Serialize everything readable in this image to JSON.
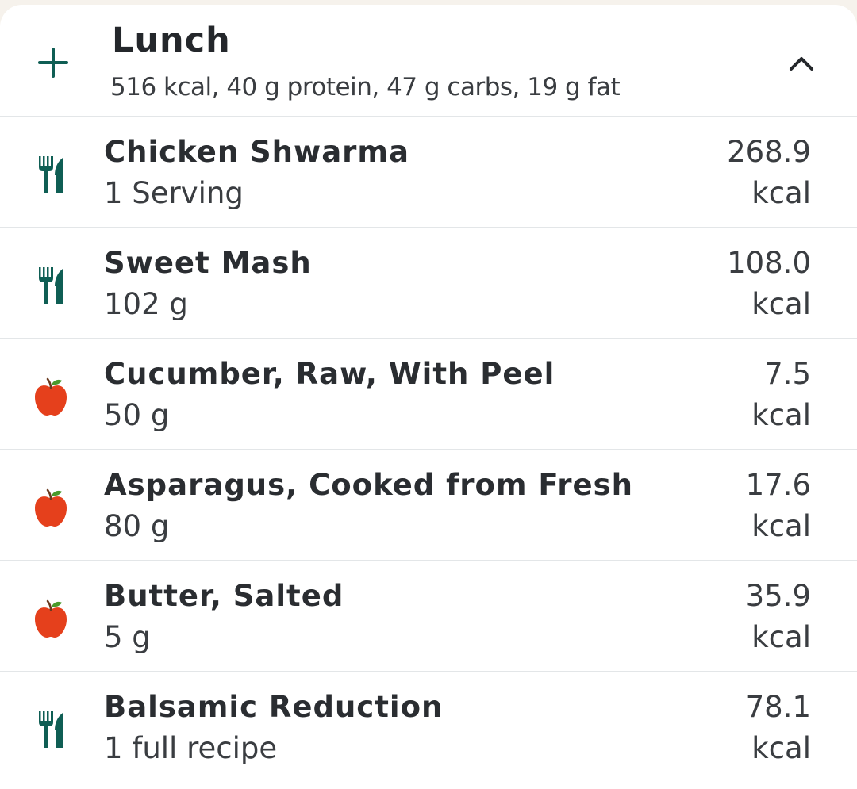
{
  "meal": {
    "title": "Lunch",
    "summary": "516 kcal, 40 g protein, 47 g carbs, 19 g fat"
  },
  "colors": {
    "accent": "#0f5e54",
    "apple": "#e5401c",
    "apple_leaf": "#4a9a2c"
  },
  "items": [
    {
      "icon": "cutlery-icon",
      "name": "Chicken Shwarma",
      "amount": "1 Serving",
      "kcal": "268.9",
      "unit": "kcal"
    },
    {
      "icon": "cutlery-icon",
      "name": "Sweet Mash",
      "amount": "102 g",
      "kcal": "108.0",
      "unit": "kcal"
    },
    {
      "icon": "apple-icon",
      "name": "Cucumber, Raw, With Peel",
      "amount": "50 g",
      "kcal": "7.5",
      "unit": "kcal"
    },
    {
      "icon": "apple-icon",
      "name": "Asparagus, Cooked from Fresh",
      "amount": "80 g",
      "kcal": "17.6",
      "unit": "kcal"
    },
    {
      "icon": "apple-icon",
      "name": "Butter, Salted",
      "amount": "5 g",
      "kcal": "35.9",
      "unit": "kcal"
    },
    {
      "icon": "cutlery-icon",
      "name": "Balsamic Reduction",
      "amount": "1 full recipe",
      "kcal": "78.1",
      "unit": "kcal"
    }
  ]
}
